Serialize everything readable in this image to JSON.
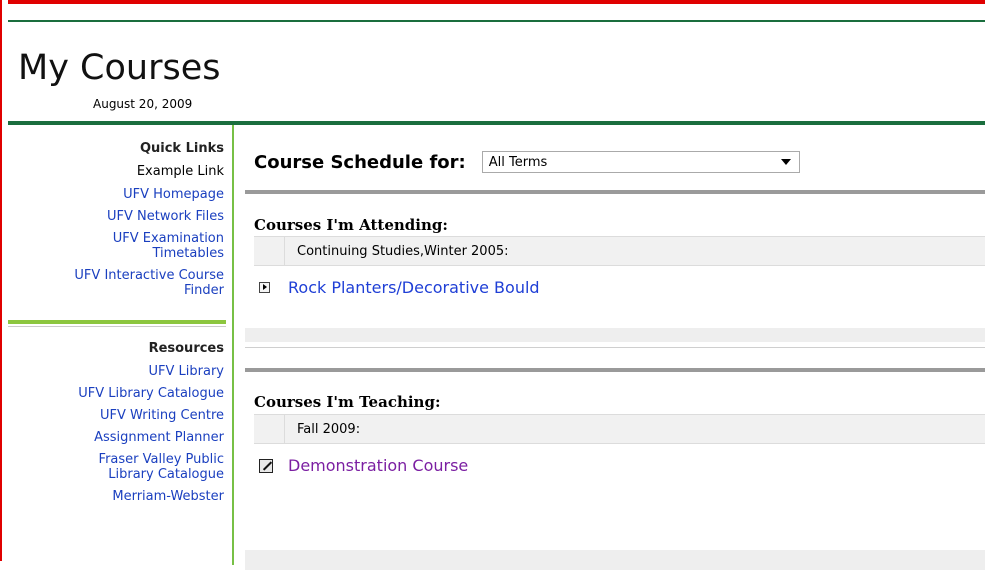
{
  "header": {
    "title": "My Courses",
    "date": "August 20, 2009"
  },
  "sidebar": {
    "quick_links": {
      "heading": "Quick Links",
      "items": [
        {
          "label": "Example Link",
          "link": false
        },
        {
          "label": "UFV Homepage",
          "link": true
        },
        {
          "label": "UFV Network Files",
          "link": true
        },
        {
          "label": "UFV Examination Timetables",
          "link": true
        },
        {
          "label": "UFV Interactive Course Finder",
          "link": true
        }
      ]
    },
    "resources": {
      "heading": "Resources",
      "items": [
        {
          "label": "UFV Library"
        },
        {
          "label": "UFV Library Catalogue"
        },
        {
          "label": "UFV Writing Centre"
        },
        {
          "label": "Assignment Planner"
        },
        {
          "label": "Fraser Valley Public Library Catalogue"
        },
        {
          "label": "Merriam-Webster"
        }
      ]
    }
  },
  "main": {
    "schedule_label": "Course Schedule for:",
    "term_select": {
      "selected": "All Terms"
    },
    "attending": {
      "title": "Courses I'm Attending:",
      "term": "Continuing Studies,Winter 2005:",
      "course": "Rock Planters/Decorative Bould",
      "course_color": "#1f3fd6"
    },
    "teaching": {
      "title": "Courses I'm Teaching:",
      "term": "Fall 2009:",
      "course": "Demonstration Course",
      "course_color": "#7b1fa2"
    }
  },
  "colors": {
    "brand_green": "#1a6e3e",
    "accent_green": "#8cc63f",
    "link_blue": "#1a3fbf",
    "frame_red": "#e00000"
  }
}
